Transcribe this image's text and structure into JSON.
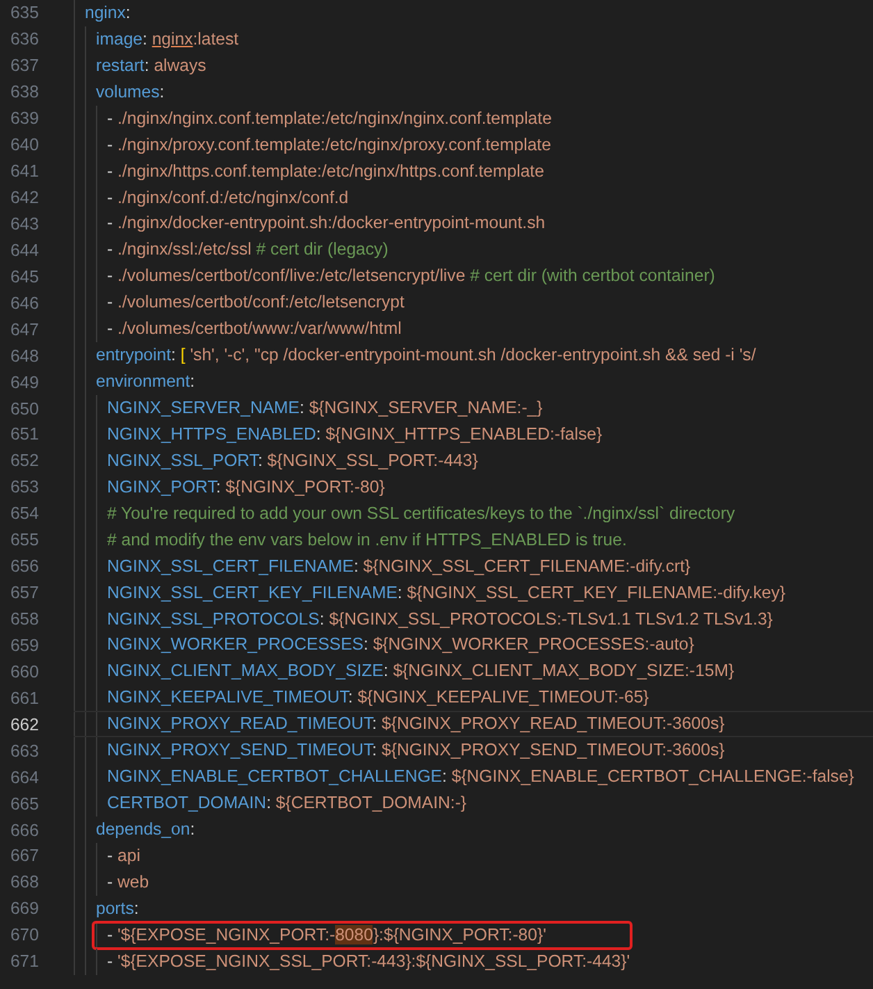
{
  "lines": [
    {
      "number": "635",
      "current": false,
      "tokens": [
        {
          "kind": "key",
          "text": "nginx"
        },
        {
          "kind": "punct",
          "text": ":"
        }
      ],
      "children": [
        {
          "number": "636",
          "current": false,
          "tokens": [
            {
              "kind": "key",
              "text": "image"
            },
            {
              "kind": "punct",
              "text": ": "
            },
            {
              "kind": "string",
              "text": "nginx",
              "underlined": true
            },
            {
              "kind": "string",
              "text": ":latest"
            }
          ]
        },
        {
          "number": "637",
          "current": false,
          "tokens": [
            {
              "kind": "key",
              "text": "restart"
            },
            {
              "kind": "punct",
              "text": ": "
            },
            {
              "kind": "string",
              "text": "always"
            }
          ]
        },
        {
          "number": "638",
          "current": false,
          "tokens": [
            {
              "kind": "key",
              "text": "volumes"
            },
            {
              "kind": "punct",
              "text": ":"
            }
          ],
          "children": [
            {
              "number": "639",
              "current": false,
              "tokens": [
                {
                  "kind": "punct",
                  "text": "- "
                },
                {
                  "kind": "string",
                  "text": "./nginx/nginx.conf.template:/etc/nginx/nginx.conf.template"
                }
              ]
            },
            {
              "number": "640",
              "current": false,
              "tokens": [
                {
                  "kind": "punct",
                  "text": "- "
                },
                {
                  "kind": "string",
                  "text": "./nginx/proxy.conf.template:/etc/nginx/proxy.conf.template"
                }
              ]
            },
            {
              "number": "641",
              "current": false,
              "tokens": [
                {
                  "kind": "punct",
                  "text": "- "
                },
                {
                  "kind": "string",
                  "text": "./nginx/https.conf.template:/etc/nginx/https.conf.template"
                }
              ]
            },
            {
              "number": "642",
              "current": false,
              "tokens": [
                {
                  "kind": "punct",
                  "text": "- "
                },
                {
                  "kind": "string",
                  "text": "./nginx/conf.d:/etc/nginx/conf.d"
                }
              ]
            },
            {
              "number": "643",
              "current": false,
              "tokens": [
                {
                  "kind": "punct",
                  "text": "- "
                },
                {
                  "kind": "string",
                  "text": "./nginx/docker-entrypoint.sh:/docker-entrypoint-mount.sh"
                }
              ]
            },
            {
              "number": "644",
              "current": false,
              "tokens": [
                {
                  "kind": "punct",
                  "text": "- "
                },
                {
                  "kind": "string",
                  "text": "./nginx/ssl:/etc/ssl "
                },
                {
                  "kind": "comment",
                  "text": "# cert dir (legacy)"
                }
              ]
            },
            {
              "number": "645",
              "current": false,
              "tokens": [
                {
                  "kind": "punct",
                  "text": "- "
                },
                {
                  "kind": "string",
                  "text": "./volumes/certbot/conf/live:/etc/letsencrypt/live "
                },
                {
                  "kind": "comment",
                  "text": "# cert dir (with certbot container)"
                }
              ]
            },
            {
              "number": "646",
              "current": false,
              "tokens": [
                {
                  "kind": "punct",
                  "text": "- "
                },
                {
                  "kind": "string",
                  "text": "./volumes/certbot/conf:/etc/letsencrypt"
                }
              ]
            },
            {
              "number": "647",
              "current": false,
              "tokens": [
                {
                  "kind": "punct",
                  "text": "- "
                },
                {
                  "kind": "string",
                  "text": "./volumes/certbot/www:/var/www/html"
                }
              ]
            }
          ]
        },
        {
          "number": "648",
          "current": false,
          "tokens": [
            {
              "kind": "key",
              "text": "entrypoint"
            },
            {
              "kind": "punct",
              "text": ": "
            },
            {
              "kind": "bracket",
              "text": "["
            },
            {
              "kind": "string",
              "text": " 'sh', '-c', \"cp /docker-entrypoint-mount.sh /docker-entrypoint.sh && sed -i 's/"
            }
          ]
        },
        {
          "number": "649",
          "current": false,
          "tokens": [
            {
              "kind": "key",
              "text": "environment"
            },
            {
              "kind": "punct",
              "text": ":"
            }
          ],
          "children": [
            {
              "number": "650",
              "current": false,
              "tokens": [
                {
                  "kind": "key",
                  "text": "NGINX_SERVER_NAME"
                },
                {
                  "kind": "punct",
                  "text": ": "
                },
                {
                  "kind": "string",
                  "text": "${NGINX_SERVER_NAME:-_}"
                }
              ]
            },
            {
              "number": "651",
              "current": false,
              "tokens": [
                {
                  "kind": "key",
                  "text": "NGINX_HTTPS_ENABLED"
                },
                {
                  "kind": "punct",
                  "text": ": "
                },
                {
                  "kind": "string",
                  "text": "${NGINX_HTTPS_ENABLED:-false}"
                }
              ]
            },
            {
              "number": "652",
              "current": false,
              "tokens": [
                {
                  "kind": "key",
                  "text": "NGINX_SSL_PORT"
                },
                {
                  "kind": "punct",
                  "text": ": "
                },
                {
                  "kind": "string",
                  "text": "${NGINX_SSL_PORT:-443}"
                }
              ]
            },
            {
              "number": "653",
              "current": false,
              "tokens": [
                {
                  "kind": "key",
                  "text": "NGINX_PORT"
                },
                {
                  "kind": "punct",
                  "text": ": "
                },
                {
                  "kind": "string",
                  "text": "${NGINX_PORT:-80}"
                }
              ]
            },
            {
              "number": "654",
              "current": false,
              "tokens": [
                {
                  "kind": "comment",
                  "text": "# You're required to add your own SSL certificates/keys to the `./nginx/ssl` directory"
                }
              ]
            },
            {
              "number": "655",
              "current": false,
              "tokens": [
                {
                  "kind": "comment",
                  "text": "# and modify the env vars below in .env if HTTPS_ENABLED is true."
                }
              ]
            },
            {
              "number": "656",
              "current": false,
              "tokens": [
                {
                  "kind": "key",
                  "text": "NGINX_SSL_CERT_FILENAME"
                },
                {
                  "kind": "punct",
                  "text": ": "
                },
                {
                  "kind": "string",
                  "text": "${NGINX_SSL_CERT_FILENAME:-dify.crt}"
                }
              ]
            },
            {
              "number": "657",
              "current": false,
              "tokens": [
                {
                  "kind": "key",
                  "text": "NGINX_SSL_CERT_KEY_FILENAME"
                },
                {
                  "kind": "punct",
                  "text": ": "
                },
                {
                  "kind": "string",
                  "text": "${NGINX_SSL_CERT_KEY_FILENAME:-dify.key}"
                }
              ]
            },
            {
              "number": "658",
              "current": false,
              "tokens": [
                {
                  "kind": "key",
                  "text": "NGINX_SSL_PROTOCOLS"
                },
                {
                  "kind": "punct",
                  "text": ": "
                },
                {
                  "kind": "string",
                  "text": "${NGINX_SSL_PROTOCOLS:-TLSv1.1 TLSv1.2 TLSv1.3}"
                }
              ]
            },
            {
              "number": "659",
              "current": false,
              "tokens": [
                {
                  "kind": "key",
                  "text": "NGINX_WORKER_PROCESSES"
                },
                {
                  "kind": "punct",
                  "text": ": "
                },
                {
                  "kind": "string",
                  "text": "${NGINX_WORKER_PROCESSES:-auto}"
                }
              ]
            },
            {
              "number": "660",
              "current": false,
              "tokens": [
                {
                  "kind": "key",
                  "text": "NGINX_CLIENT_MAX_BODY_SIZE"
                },
                {
                  "kind": "punct",
                  "text": ": "
                },
                {
                  "kind": "string",
                  "text": "${NGINX_CLIENT_MAX_BODY_SIZE:-15M}"
                }
              ]
            },
            {
              "number": "661",
              "current": false,
              "tokens": [
                {
                  "kind": "key",
                  "text": "NGINX_KEEPALIVE_TIMEOUT"
                },
                {
                  "kind": "punct",
                  "text": ": "
                },
                {
                  "kind": "string",
                  "text": "${NGINX_KEEPALIVE_TIMEOUT:-65}"
                }
              ]
            },
            {
              "number": "662",
              "current": true,
              "tokens": [
                {
                  "kind": "key",
                  "text": "NGINX_PROXY_READ_TIMEOUT"
                },
                {
                  "kind": "punct",
                  "text": ": "
                },
                {
                  "kind": "string",
                  "text": "${NGINX_PROXY_READ_TIMEOUT:-3600s}"
                }
              ]
            },
            {
              "number": "663",
              "current": false,
              "tokens": [
                {
                  "kind": "key",
                  "text": "NGINX_PROXY_SEND_TIMEOUT"
                },
                {
                  "kind": "punct",
                  "text": ": "
                },
                {
                  "kind": "string",
                  "text": "${NGINX_PROXY_SEND_TIMEOUT:-3600s}"
                }
              ]
            },
            {
              "number": "664",
              "current": false,
              "tokens": [
                {
                  "kind": "key",
                  "text": "NGINX_ENABLE_CERTBOT_CHALLENGE"
                },
                {
                  "kind": "punct",
                  "text": ": "
                },
                {
                  "kind": "string",
                  "text": "${NGINX_ENABLE_CERTBOT_CHALLENGE:-false}"
                }
              ]
            },
            {
              "number": "665",
              "current": false,
              "tokens": [
                {
                  "kind": "key",
                  "text": "CERTBOT_DOMAIN"
                },
                {
                  "kind": "punct",
                  "text": ": "
                },
                {
                  "kind": "string",
                  "text": "${CERTBOT_DOMAIN:-}"
                }
              ]
            }
          ]
        },
        {
          "number": "666",
          "current": false,
          "tokens": [
            {
              "kind": "key",
              "text": "depends_on"
            },
            {
              "kind": "punct",
              "text": ":"
            }
          ],
          "children": [
            {
              "number": "667",
              "current": false,
              "tokens": [
                {
                  "kind": "punct",
                  "text": "- "
                },
                {
                  "kind": "string",
                  "text": "api"
                }
              ]
            },
            {
              "number": "668",
              "current": false,
              "tokens": [
                {
                  "kind": "punct",
                  "text": "- "
                },
                {
                  "kind": "string",
                  "text": "web"
                }
              ]
            }
          ]
        },
        {
          "number": "669",
          "current": false,
          "tokens": [
            {
              "kind": "key",
              "text": "ports"
            },
            {
              "kind": "punct",
              "text": ":"
            }
          ],
          "children": [
            {
              "number": "670",
              "current": false,
              "boxed": true,
              "tokens": [
                {
                  "kind": "punct",
                  "text": "- "
                },
                {
                  "kind": "string",
                  "text": "'${EXPOSE_NGINX_PORT:-"
                },
                {
                  "kind": "string",
                  "text": "8080",
                  "highlighted": true
                },
                {
                  "kind": "string",
                  "text": "}:${NGINX_PORT:-80}'"
                }
              ]
            },
            {
              "number": "671",
              "current": false,
              "tokens": [
                {
                  "kind": "punct",
                  "text": "- "
                },
                {
                  "kind": "string",
                  "text": "'${EXPOSE_NGINX_SSL_PORT:-443}:${NGINX_SSL_PORT:-443}'"
                }
              ]
            }
          ]
        }
      ]
    }
  ]
}
